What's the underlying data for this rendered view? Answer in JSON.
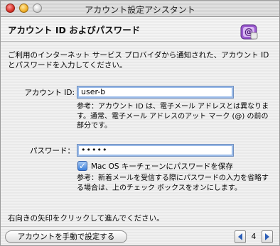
{
  "window": {
    "title": "アカウント設定アシスタント"
  },
  "header": {
    "title": "アカウント ID およびパスワード",
    "icon": "mail-app-icon"
  },
  "intro": {
    "text": "ご利用のインターネット サービス プロバイダから通知された、アカウント ID とパスワードを入力してください。"
  },
  "account_id": {
    "label": "アカウント ID:",
    "value": "user-b",
    "hint": "参考：アカウント ID は、電子メール アドレスとは異なります。通常、電子メール アドレスのアット マーク (@) の前の部分です。"
  },
  "password": {
    "label": "パスワード：",
    "value": "•••••"
  },
  "save_password": {
    "label": "Mac OS キーチェーンにパスワードを保存",
    "checked": true,
    "hint": "参考：新着メールを受信する際にパスワードの入力を省略する場合は、上のチェック ボックスをオンにします。"
  },
  "footer": {
    "instruction": "右向きの矢印をクリックして進んでください。",
    "manual_button": "アカウントを手動で設定する",
    "page_number": "4"
  }
}
